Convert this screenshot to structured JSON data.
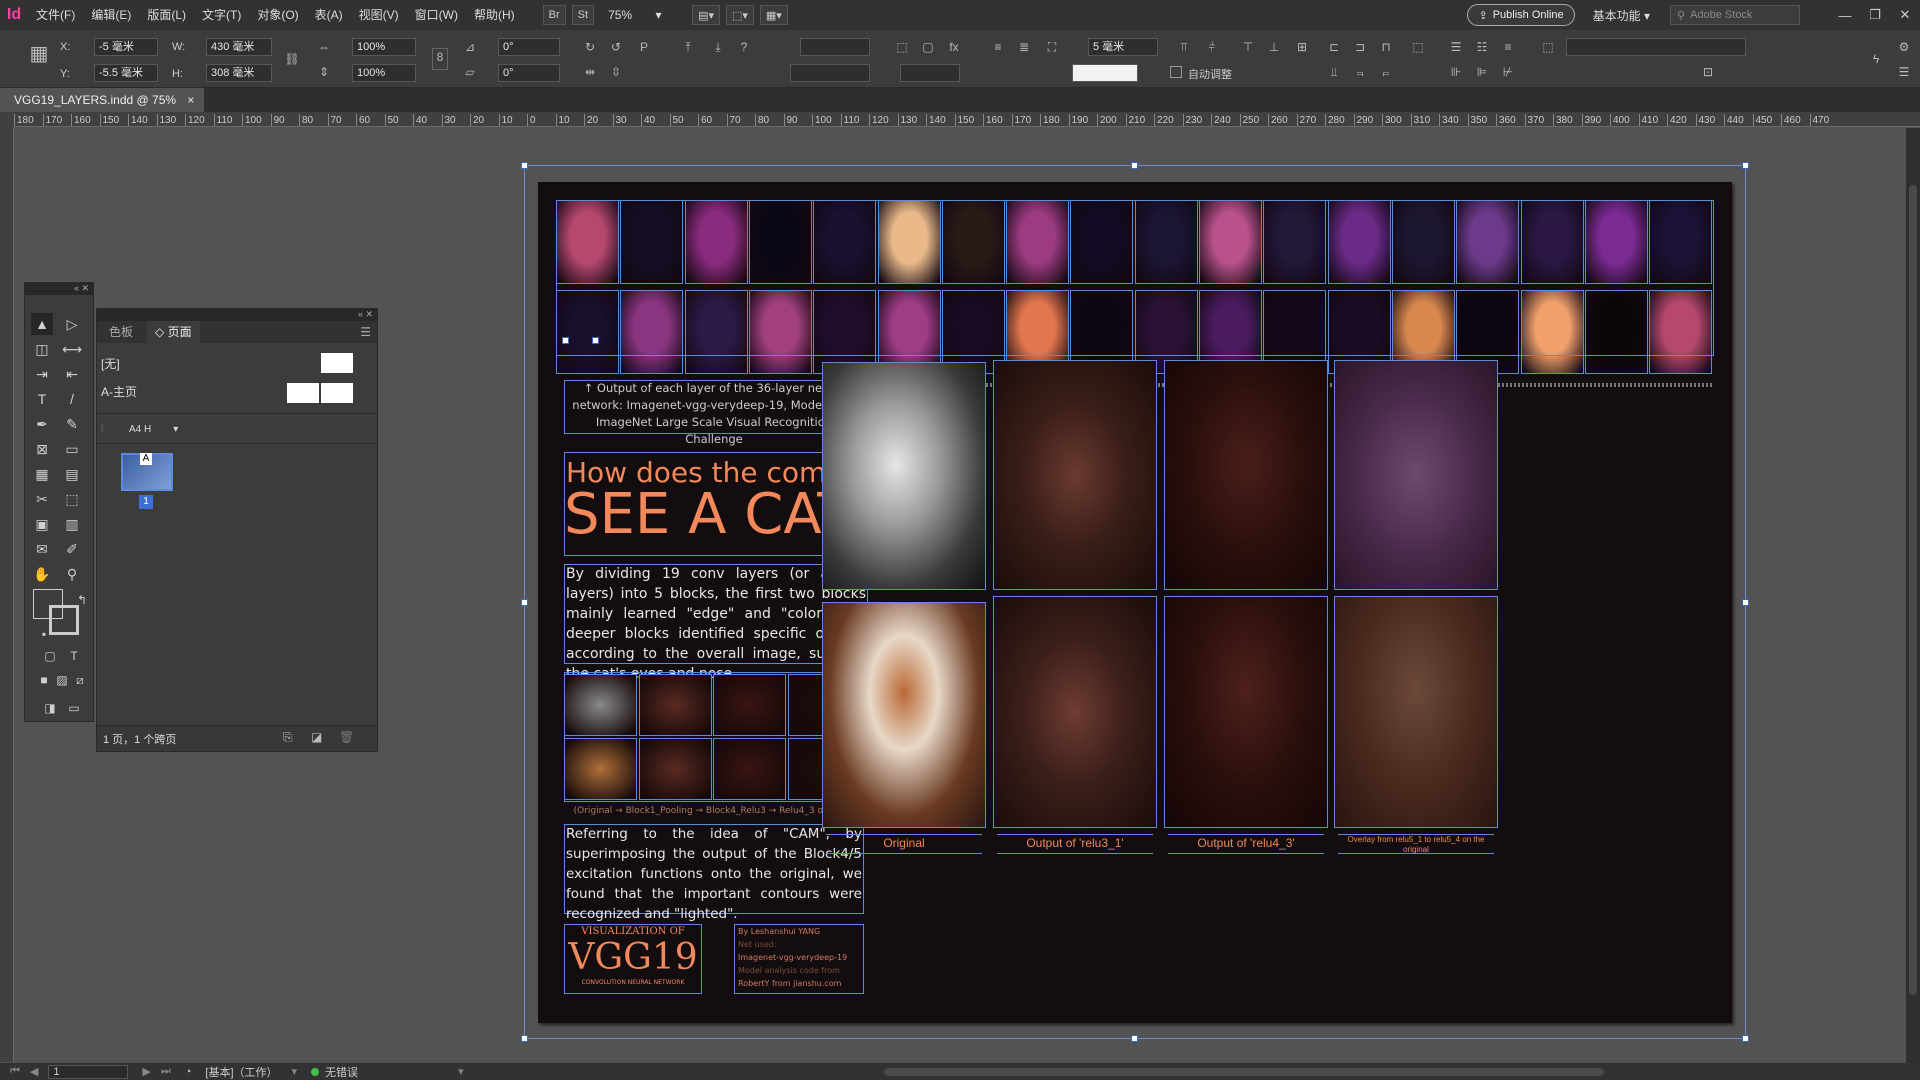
{
  "app": {
    "logo": "Id"
  },
  "menu": [
    "文件(F)",
    "编辑(E)",
    "版面(L)",
    "文字(T)",
    "对象(O)",
    "表(A)",
    "视图(V)",
    "窗口(W)",
    "帮助(H)"
  ],
  "toolbar": {
    "br": "Br",
    "st": "St",
    "zoom": "75%",
    "publish": "Publish Online",
    "workspace": "基本功能",
    "search_placeholder": "Adobe Stock"
  },
  "control": {
    "x_label": "X:",
    "x": "-5 毫米",
    "y_label": "Y:",
    "y": "-5.5 毫米",
    "w_label": "W:",
    "w": "430 毫米",
    "h_label": "H:",
    "h": "308 毫米",
    "scale_x": "100%",
    "scale_y": "100%",
    "rotate": "0°",
    "shear": "0°",
    "stroke": "5 毫米",
    "autofit": "自动调整"
  },
  "doc_tab": {
    "name": "VGG19_LAYERS.indd @ 75%",
    "close": "×"
  },
  "ruler_ticks": [
    "180",
    "170",
    "160",
    "150",
    "140",
    "130",
    "120",
    "110",
    "100",
    "90",
    "80",
    "70",
    "60",
    "50",
    "40",
    "30",
    "20",
    "10",
    "0",
    "10",
    "20",
    "30",
    "40",
    "50",
    "60",
    "70",
    "80",
    "90",
    "100",
    "110",
    "120",
    "130",
    "140",
    "150",
    "160",
    "170",
    "180",
    "190",
    "200",
    "210",
    "220",
    "230",
    "240",
    "250",
    "260",
    "270",
    "280",
    "290",
    "300",
    "310",
    "340",
    "350",
    "360",
    "370",
    "380",
    "390",
    "400",
    "410",
    "420",
    "430",
    "440",
    "450",
    "460",
    "470"
  ],
  "pages_panel": {
    "tab_swatches": "色板",
    "tab_pages": "◇ 页面",
    "none": "[无]",
    "master": "A-主页",
    "size": "A4 H",
    "page_master_letter": "A",
    "page_num": "1",
    "footer": "1 页，1 个跨页"
  },
  "status": {
    "page": "1",
    "mode": "[基本]（工作）",
    "errors": "无错误"
  },
  "poster": {
    "caption_top": "↑ Output of each layer of the 36-layer neural network: Imagenet-vgg-verydeep-19, Model from ImageNet Large Scale Visual Recognition Challenge",
    "heading1": "How does the computer",
    "heading2": "SEE A CAT?",
    "paragraph1": "By dividing 19 conv layers (or all 36 layers) into 5 blocks, the first two blocks mainly learned \"edge\" and \"color\", the deeper blocks identified specific objects according to the overall image, such as the cat's eyes and nose.",
    "small_caption": "(Original → Block1_Pooling → Block4_Relu3 → Relu4_3 overlay)",
    "paragraph2": "Referring to the idea of \"CAM\", by superimposing the output of the Block4/5 excitation functions onto the original, we found that the important contours were recognized and \"lighted\".",
    "logo_top": "VISUALIZATION OF",
    "logo_main": "VGG19",
    "logo_bottom": "CONVOLUTION NEURAL NETWORK",
    "credits": [
      "By Leshanshui YANG",
      "Net used:",
      "Imagenet-vgg-verydeep-19",
      "Model analysis code from",
      "RobertY from jianshu.com"
    ],
    "col_captions": [
      "Original",
      "Output of 'relu3_1'",
      "Output of 'relu4_3'",
      "Overlay from relu5_1 to relu5_4 on the original"
    ]
  },
  "colors": {
    "accent": "#f3895a",
    "selection": "#5d8bdc",
    "page_bg": "#130d10"
  }
}
